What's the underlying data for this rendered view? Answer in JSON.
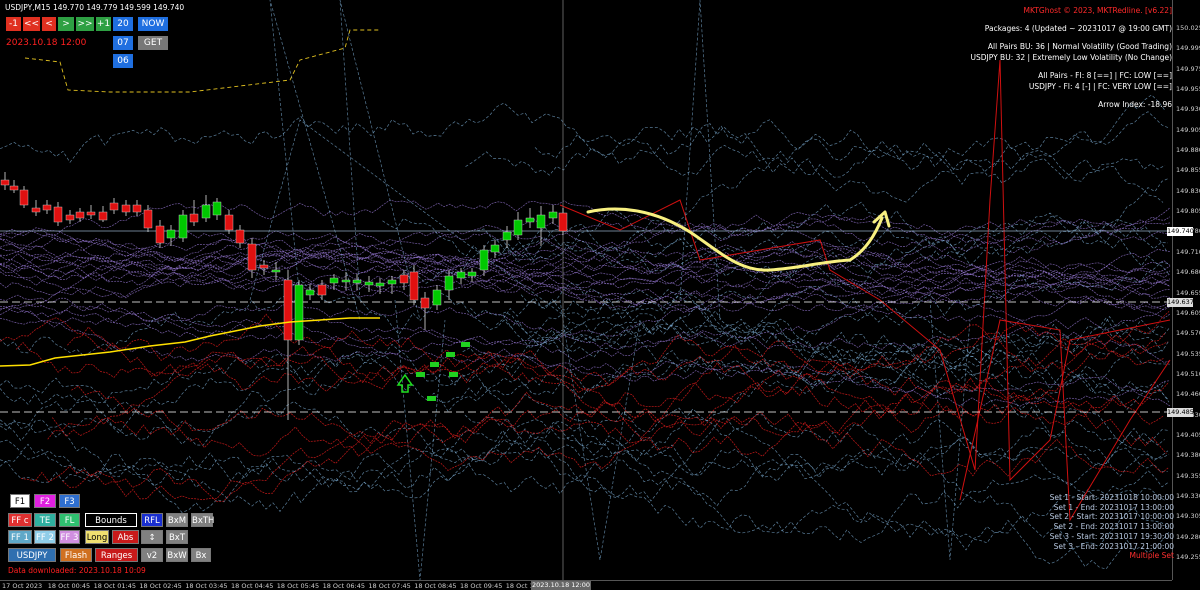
{
  "symbol": {
    "header": "USDJPY,M15  149.770 149.779 149.599 149.740"
  },
  "nav": {
    "buttons": [
      {
        "label": "-1",
        "color": "#e03020"
      },
      {
        "label": "<<",
        "color": "#e03020"
      },
      {
        "label": "<",
        "color": "#e03020"
      },
      {
        "label": ">",
        "color": "#2ea043"
      },
      {
        "label": ">>",
        "color": "#2ea043"
      },
      {
        "label": "+1",
        "color": "#2ea043"
      }
    ],
    "right_buttons": [
      {
        "label": "20",
        "color": "#1f6fe0"
      },
      {
        "label": "NOW",
        "color": "#1f6fe0"
      },
      {
        "label": "07",
        "color": "#1f6fe0"
      },
      {
        "label": "GET",
        "color": "#777777"
      },
      {
        "label": "06",
        "color": "#1f6fe0"
      }
    ],
    "date": "2023.10.18 12:00"
  },
  "info_panel": {
    "title": "MKTGhost © 2023, MKTRedline. [v6.22]",
    "packages": "Packages: 4 (Updated ~ 20231017 @ 19:00 GMT)",
    "all_pairs_bu": "All Pairs BU: 36 | Normal Volatility (Good Trading)",
    "usdjpy_bu": "USDJPY BU: 32 | Extremely Low Volatility (No Change)",
    "all_pairs_fi": "All Pairs - FI: 8 [==] | FC: LOW  [==]",
    "usdjpy_fi": "USDJPY - FI: 4 [-] | FC: VERY LOW [==]",
    "arrow_index": "Arrow Index: -18.96"
  },
  "toolbar": {
    "buttons": [
      {
        "label": "F1",
        "bg": "#ffffff",
        "fg": "#000000"
      },
      {
        "label": "F2",
        "bg": "#e020e0",
        "fg": "#ffffff"
      },
      {
        "label": "F3",
        "bg": "#2f6fd0",
        "fg": "#ffffff"
      },
      {
        "label": "FF c",
        "bg": "#e03030",
        "fg": "#ffffff"
      },
      {
        "label": "TE",
        "bg": "#2fb0a0",
        "fg": "#ffffff"
      },
      {
        "label": "FL",
        "bg": "#2fc070",
        "fg": "#ffffff"
      },
      {
        "label": "Bounds",
        "bg": "#000000",
        "fg": "#ffffff"
      },
      {
        "label": "RFL",
        "bg": "#1a2fd0",
        "fg": "#ffffff"
      },
      {
        "label": "BxM",
        "bg": "#808080",
        "fg": "#ffffff"
      },
      {
        "label": "BxTH",
        "bg": "#808080",
        "fg": "#ffffff"
      },
      {
        "label": "FF 1",
        "bg": "#5fa8c8",
        "fg": "#ffffff"
      },
      {
        "label": "FF 2",
        "bg": "#8fcde8",
        "fg": "#ffffff"
      },
      {
        "label": "FF 3",
        "bg": "#d08fe0",
        "fg": "#ffffff"
      },
      {
        "label": "Long",
        "bg": "#f0e070",
        "fg": "#000000"
      },
      {
        "label": "Abs",
        "bg": "#c81a1a",
        "fg": "#ffffff"
      },
      {
        "label": "↕",
        "bg": "#808080",
        "fg": "#ffffff"
      },
      {
        "label": "BxT",
        "bg": "#808080",
        "fg": "#ffffff"
      },
      {
        "label": "USDJPY",
        "bg": "#2f6fb0",
        "fg": "#ffffff"
      },
      {
        "label": "Flash",
        "bg": "#d07020",
        "fg": "#ffffff"
      },
      {
        "label": "Ranges",
        "bg": "#c81a1a",
        "fg": "#ffffff"
      },
      {
        "label": "v2",
        "bg": "#808080",
        "fg": "#ffffff"
      },
      {
        "label": "BxW",
        "bg": "#808080",
        "fg": "#ffffff"
      },
      {
        "label": "Bx",
        "bg": "#808080",
        "fg": "#ffffff"
      }
    ],
    "download": "Data downloaded: 2023.10.18 10:09"
  },
  "sets_panel": {
    "lines": [
      "Set 1 - Start: 20231018 10:00:00",
      "Set 1 - End: 20231017 13:00:00",
      "Set 2 - Start: 20231017 10:00:00",
      "Set 2 - End: 20231017 13:00:00",
      "Set 3 - Start: 20231017 19:30:00",
      "Set 3 - End: 20231017 21:00:00"
    ],
    "footer": "Multiple Set"
  },
  "price_axis": {
    "ticks": [
      "150.025",
      "149.999",
      "149.975",
      "149.955",
      "149.930",
      "149.905",
      "149.880",
      "149.855",
      "149.830",
      "149.805",
      "149.780",
      "149.710",
      "149.680",
      "149.655",
      "149.605",
      "149.570",
      "149.535",
      "149.510",
      "149.460",
      "149.430",
      "149.405",
      "149.380",
      "149.355",
      "149.330",
      "149.305",
      "149.280",
      "149.255"
    ],
    "current": "149.740",
    "upper_level": "149.637",
    "lower_level": "149.485"
  },
  "time_axis": {
    "ticks": [
      "17 Oct 2023",
      "18 Oct 00:45",
      "18 Oct 01:45",
      "18 Oct 02:45",
      "18 Oct 03:45",
      "18 Oct 04:45",
      "18 Oct 05:45",
      "18 Oct 06:45",
      "18 Oct 07:45",
      "18 Oct 08:45",
      "18 Oct 09:45",
      "18 Oct 10:45"
    ],
    "current": "2023.10.18 12:00"
  },
  "colors": {
    "bull": "#00c800",
    "bear": "#e01010",
    "ghost_red": "#cc1a1a",
    "ghost_blue": "#7fb0d8",
    "ghost_purple": "#9a7ad8",
    "yellow": "#f0e050"
  }
}
